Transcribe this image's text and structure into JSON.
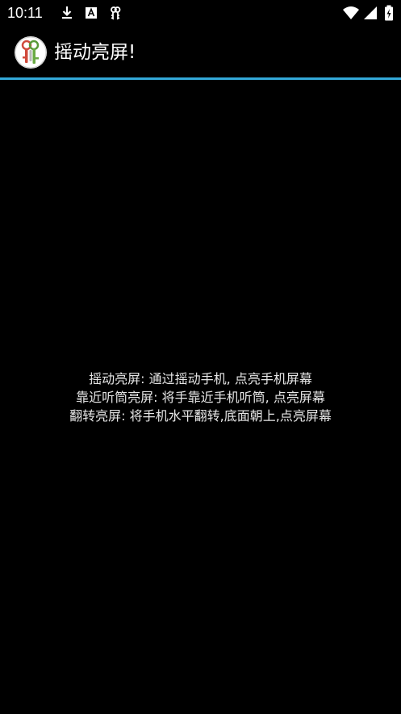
{
  "status_bar": {
    "time": "10:11",
    "left_icons": [
      "download-icon",
      "a-notification-icon",
      "keys-notification-icon"
    ],
    "right_icons": [
      "wifi-icon",
      "cell-signal-icon",
      "battery-charging-icon"
    ]
  },
  "action_bar": {
    "app_icon": "keys-app-icon",
    "title": "摇动亮屏!"
  },
  "colors": {
    "background": "#000000",
    "accent": "#33a9d9",
    "text": "#e6e6e6"
  },
  "main": {
    "lines": [
      "摇动亮屏: 通过摇动手机, 点亮手机屏幕",
      "靠近听筒亮屏: 将手靠近手机听筒, 点亮屏幕",
      "翻转亮屏: 将手机水平翻转,底面朝上,点亮屏幕"
    ]
  }
}
